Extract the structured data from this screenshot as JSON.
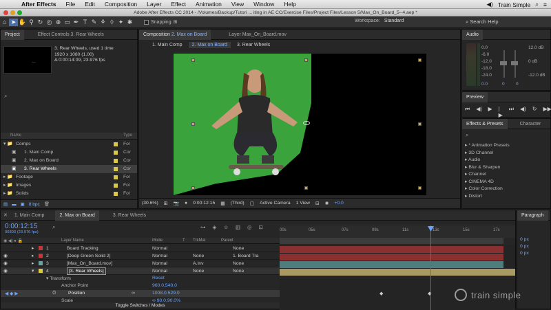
{
  "menubar": {
    "app": "After Effects",
    "items": [
      "File",
      "Edit",
      "Composition",
      "Layer",
      "Effect",
      "Animation",
      "View",
      "Window",
      "Help"
    ],
    "brand": "Train Simple"
  },
  "window_title": "Adobe After Effects CC 2014 - /Volumes/Backup/Tutori ... iting in AE CC/Exercise Files/Project Files/Lesson 5/Max_On_Board_5--4.aep *",
  "toolbar": {
    "snapping": "Snapping",
    "workspace_label": "Workspace:",
    "workspace_value": "Standard",
    "search_help": "Search Help"
  },
  "project": {
    "tab": "Project",
    "tab2": "Effect Controls 3. Rear Wheels",
    "selected_name": "3. Rear Wheels",
    "used": ", used 1 time",
    "dims": "1920 x 1080 (1.00)",
    "duration": "Δ 0:00:14:09, 23.976 fps",
    "col_name": "Name",
    "col_type": "Type",
    "items": [
      {
        "name": "Comps",
        "type": "Fol",
        "color": "#d9c94a",
        "indent": 0
      },
      {
        "name": "1. Main Comp",
        "type": "Cor",
        "color": "#d9c94a",
        "indent": 2
      },
      {
        "name": "2. Max on Board",
        "type": "Cor",
        "color": "#d9c94a",
        "indent": 2
      },
      {
        "name": "3. Rear Wheels",
        "type": "Cor",
        "color": "#d9c94a",
        "indent": 2
      },
      {
        "name": "Footage",
        "type": "Fol",
        "color": "#d9c94a",
        "indent": 0
      },
      {
        "name": "Images",
        "type": "Fol",
        "color": "#d9c94a",
        "indent": 0
      },
      {
        "name": "Solids",
        "type": "Fol",
        "color": "#d9c94a",
        "indent": 0
      }
    ],
    "bpc": "8 bpc"
  },
  "comp": {
    "tab": "Composition",
    "tab_name": "2. Max on Board",
    "layer_tab": "Layer Max_On_Board.mov",
    "subtabs": [
      "1. Main Comp",
      "2. Max on Board",
      "3. Rear Wheels"
    ],
    "zoom": "(30.6%)",
    "timecode": "0:00:12:15",
    "resolution": "(Third)",
    "camera": "Active Camera",
    "view": "1 View",
    "exposure": "+0.0"
  },
  "audio": {
    "tab": "Audio",
    "left_levels": [
      "0.0",
      "-6.0",
      "-12.0",
      "-18.0",
      "-24.0"
    ],
    "right_levels": [
      "12.0 dB",
      "0 dB",
      "-12.0 dB"
    ],
    "bottom": [
      "0.0",
      "0",
      "0"
    ]
  },
  "preview": {
    "tab": "Preview"
  },
  "effects": {
    "tab": "Effects & Presets",
    "tab2": "Character",
    "items": [
      "* Animation Presets",
      "3D Channel",
      "Audio",
      "Blur & Sharpen",
      "Channel",
      "CINEMA 4D",
      "Color Correction",
      "Distort"
    ]
  },
  "timeline": {
    "tabs": [
      "1. Main Comp",
      "2. Max on Board",
      "3. Rear Wheels"
    ],
    "timecode": "0:00:12:15",
    "fps": "00303 (23.976 fps)",
    "col_layer": "Layer Name",
    "col_mode": "Mode",
    "col_t": "T",
    "col_trkmat": "TrkMat",
    "col_parent": "Parent",
    "layers": [
      {
        "num": "1",
        "name": "Board Tracking",
        "mode": "Normal",
        "trk": "",
        "parent": "None",
        "color": "#c03a3a"
      },
      {
        "num": "2",
        "name": "[Deep Green Solid 2]",
        "mode": "Normal",
        "trk": "None",
        "parent": "1. Board Tra",
        "color": "#c03a3a"
      },
      {
        "num": "3",
        "name": "[Max_On_Board.mov]",
        "mode": "Normal",
        "trk": "A.Inv",
        "parent": "None",
        "color": "#6aa3a3"
      },
      {
        "num": "4",
        "name": "[3. Rear Wheels]",
        "mode": "Normal",
        "trk": "None",
        "parent": "None",
        "color": "#d9c94a"
      }
    ],
    "transform": "Transform",
    "reset": "Reset",
    "props": [
      {
        "name": "Anchor Point",
        "value": "960.0,540.0"
      },
      {
        "name": "Position",
        "value": "1008.0,529.0"
      },
      {
        "name": "Scale",
        "value": "∞ 90.0,90.0%"
      }
    ],
    "ruler": [
      "00s",
      "05s",
      "07s",
      "09s",
      "11s",
      "13s",
      "15s",
      "17s"
    ],
    "toggle": "Toggle Switches / Modes"
  },
  "paragraph": {
    "tab": "Paragraph",
    "vals": [
      "0 px",
      "0 px",
      "0 px"
    ]
  },
  "watermark": "train simple"
}
